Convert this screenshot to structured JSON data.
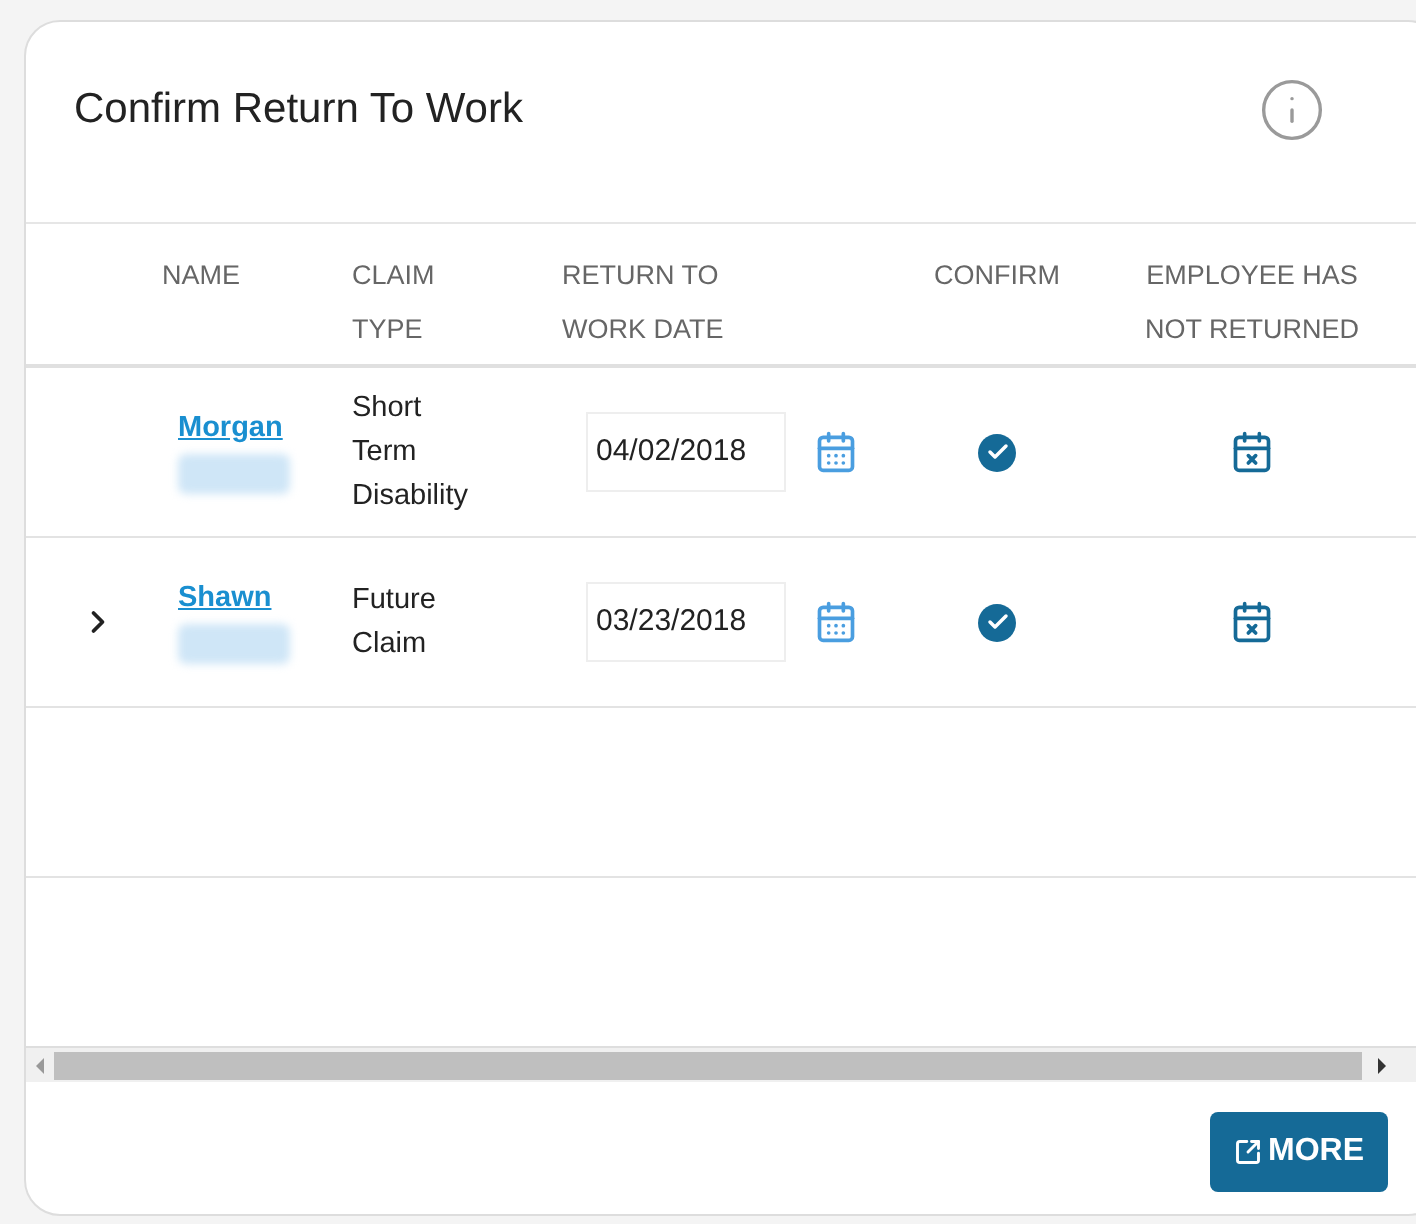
{
  "title": "Confirm Return To Work",
  "columns": [
    "NAME",
    "CLAIM TYPE",
    "RETURN TO WORK DATE",
    "CONFIRM",
    "EMPLOYEE HAS NOT RETURNED"
  ],
  "rows": [
    {
      "expandable": false,
      "name": "Morgan",
      "claim_type": "Short Term Disability",
      "date": "04/02/2018"
    },
    {
      "expandable": true,
      "name": "Shawn",
      "claim_type": "Future Claim",
      "date": "03/23/2018"
    }
  ],
  "more_button": "MORE"
}
